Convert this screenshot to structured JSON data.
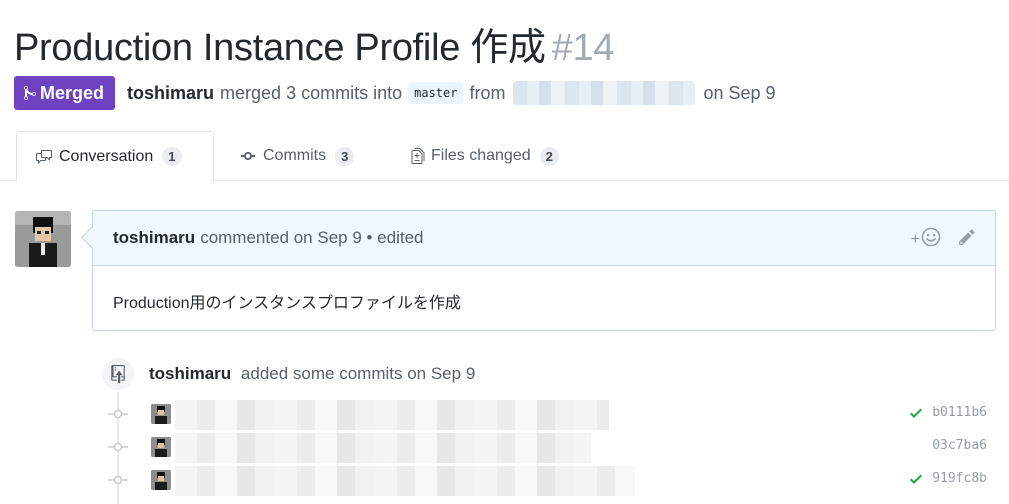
{
  "pr": {
    "title": "Production Instance Profile 作成",
    "number": "#14",
    "state": "Merged",
    "author": "toshimaru",
    "merge_text": "merged 3 commits into",
    "base_branch": "master",
    "from_text": "from",
    "date_text": "on Sep 9"
  },
  "tabs": [
    {
      "label": "Conversation",
      "count": "1"
    },
    {
      "label": "Commits",
      "count": "3"
    },
    {
      "label": "Files changed",
      "count": "2"
    }
  ],
  "comment": {
    "author": "toshimaru",
    "meta": "commented on Sep 9 • edited",
    "add_reaction": "+",
    "body": "Production用のインスタンスプロファイルを作成"
  },
  "push_event": {
    "author": "toshimaru",
    "text": "added some commits on Sep 9"
  },
  "commits": [
    {
      "sha": "b0111b6",
      "status": "success"
    },
    {
      "sha": "03c7ba6",
      "status": "none"
    },
    {
      "sha": "919fc8b",
      "status": "success"
    }
  ],
  "colors": {
    "merged": "#6f42c1",
    "success": "#28a745",
    "comment_header": "#f1f8ff"
  },
  "icons": {
    "merged": "git-merge-icon",
    "conversation": "comment-discussion-icon",
    "commits": "git-commit-icon",
    "files": "diff-icon",
    "reaction": "smiley-icon",
    "edit": "pencil-icon",
    "push": "repo-push-icon",
    "status": "check-icon"
  }
}
